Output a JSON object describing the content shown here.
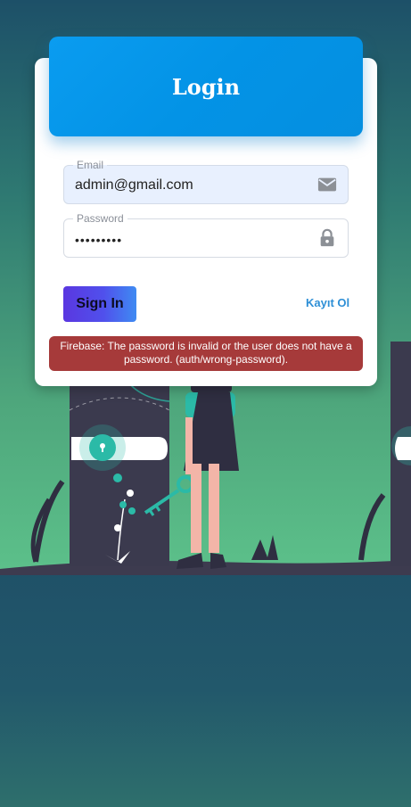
{
  "login": {
    "title": "Login",
    "email": {
      "label": "Email",
      "value": "admin@gmail.com"
    },
    "password": {
      "label": "Password",
      "value": "•••••••••"
    },
    "signin_label": "Sign In",
    "register_label": "Kayıt Ol",
    "error_message": "Firebase: The password is invalid or the user does not have a password. (auth/wrong-password)."
  },
  "icons": {
    "email": "mail-icon",
    "password": "lock-icon"
  },
  "colors": {
    "header_blue": "#0a9cf0",
    "error_red": "#a63a3a",
    "link_blue": "#2e8fd6",
    "button_gradient_start": "#5a37e0",
    "button_gradient_end": "#3f8bf2"
  }
}
